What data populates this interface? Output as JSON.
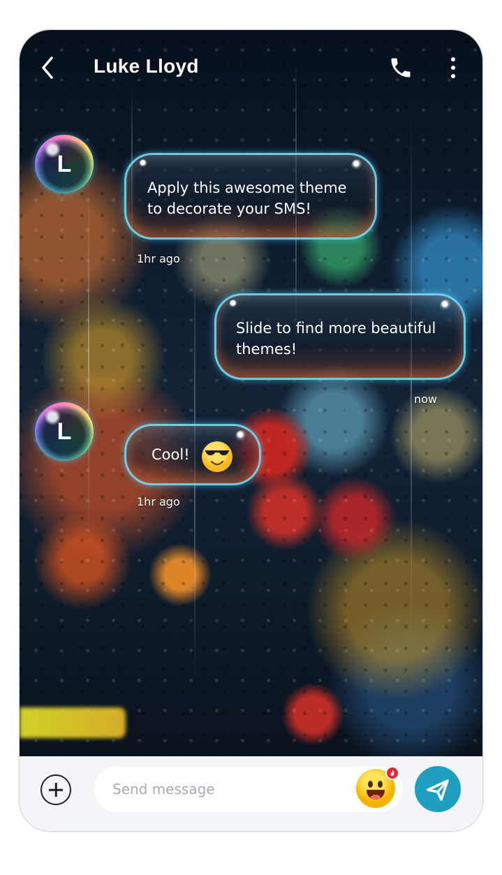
{
  "header": {
    "title": "Luke Lloyd",
    "back_icon": "chevron-left-icon",
    "call_icon": "phone-icon",
    "more_icon": "more-vertical-icon"
  },
  "messages": [
    {
      "direction": "incoming",
      "avatar_letter": "L",
      "text_line1": "Apply this awesome theme",
      "text_line2": "to decorate your SMS!",
      "time": "1hr ago"
    },
    {
      "direction": "outgoing",
      "text_line1": "Slide to find more beautiful",
      "text_line2": "themes!",
      "time": "now"
    },
    {
      "direction": "incoming",
      "avatar_letter": "L",
      "text": "Cool!",
      "emoji": "smiling-face-with-sunglasses-icon",
      "time": "1hr ago"
    }
  ],
  "composer": {
    "add_icon": "plus-circle-icon",
    "placeholder": "Send message",
    "emoji_icon": "grinning-face-icon",
    "send_icon": "send-icon"
  },
  "colors": {
    "bubble_border": "#78e6ff",
    "send_button": "#1f9fc0",
    "badge": "#e8262d",
    "composer_bg": "#f4f5f8"
  }
}
